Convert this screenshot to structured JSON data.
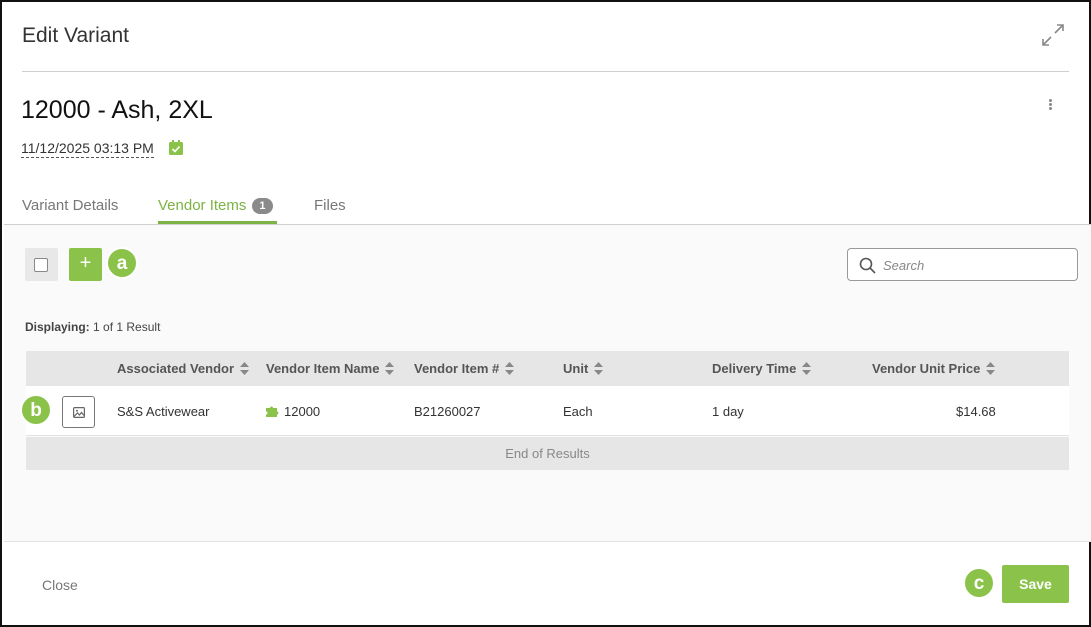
{
  "dialog": {
    "title": "Edit Variant",
    "expand_icon": "expand-arrows-icon"
  },
  "variant": {
    "title": "12000 - Ash, 2XL",
    "datetime": "11/12/2025 03:13 PM",
    "calendar_icon": "calendar-check-icon",
    "more_icon": "kebab-menu-icon"
  },
  "tabs": [
    {
      "label": "Variant Details",
      "active": false
    },
    {
      "label": "Vendor Items",
      "badge": "1",
      "active": true
    },
    {
      "label": "Files",
      "active": false
    }
  ],
  "toolbar": {
    "add_label": "+",
    "search_placeholder": "Search"
  },
  "callouts": {
    "a": "a",
    "b": "b",
    "c": "c"
  },
  "results": {
    "prefix": "Displaying:",
    "text": "1 of 1 Result",
    "end_text": "End of Results"
  },
  "table": {
    "columns": [
      "Associated Vendor",
      "Vendor Item Name",
      "Vendor Item #",
      "Unit",
      "Delivery Time",
      "Vendor Unit Price"
    ],
    "rows": [
      {
        "vendor": "S&S Activewear",
        "item_name": "12000",
        "item_number": "B21260027",
        "unit": "Each",
        "delivery_time": "1 day",
        "unit_price": "$14.68"
      }
    ]
  },
  "footer": {
    "close_label": "Close",
    "save_label": "Save"
  },
  "colors": {
    "accent": "#8bc34a",
    "active_tab": "#7cb342"
  }
}
